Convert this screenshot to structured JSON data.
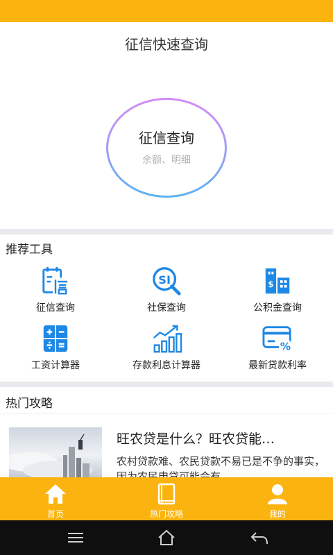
{
  "header": {
    "title": "征信快速查询"
  },
  "hero": {
    "title": "征信查询",
    "subtitle": "余额、明细"
  },
  "tools": {
    "section_title": "推荐工具",
    "items": [
      {
        "label": "征信查询",
        "icon": "credit-report-icon"
      },
      {
        "label": "社保查询",
        "icon": "social-security-icon"
      },
      {
        "label": "公积金查询",
        "icon": "housing-fund-icon"
      },
      {
        "label": "工资计算器",
        "icon": "calculator-icon"
      },
      {
        "label": "存款利息计算器",
        "icon": "interest-chart-icon"
      },
      {
        "label": "最新贷款利率",
        "icon": "loan-rate-card-icon"
      }
    ]
  },
  "guides": {
    "section_title": "热门攻略",
    "article": {
      "title": "旺农贷是什么？旺农贷能…",
      "description": "农村贷款难、农民贷款不易已是不争的事实，因为农民申贷可能会有"
    }
  },
  "tabbar": {
    "items": [
      {
        "label": "首页",
        "icon": "home-icon"
      },
      {
        "label": "热门攻略",
        "icon": "book-icon"
      },
      {
        "label": "我的",
        "icon": "user-icon"
      }
    ]
  },
  "colors": {
    "accent": "#fbb40f",
    "icon_blue": "#1e88e5"
  }
}
